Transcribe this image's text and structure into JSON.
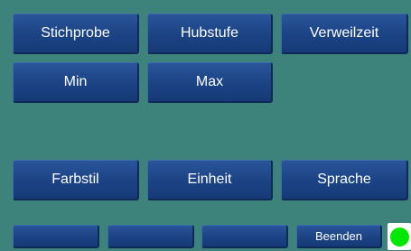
{
  "main_buttons": {
    "stichprobe": "Stichprobe",
    "hubstufe": "Hubstufe",
    "verweilzeit": "Verweilzeit",
    "min": "Min",
    "max": "Max",
    "farbstil": "Farbstil",
    "einheit": "Einheit",
    "sprache": "Sprache"
  },
  "footer": {
    "slot1": "",
    "slot2": "",
    "slot3": "",
    "beenden": "Beenden"
  },
  "status": {
    "indicator_color": "#00e800",
    "state": "ok"
  }
}
